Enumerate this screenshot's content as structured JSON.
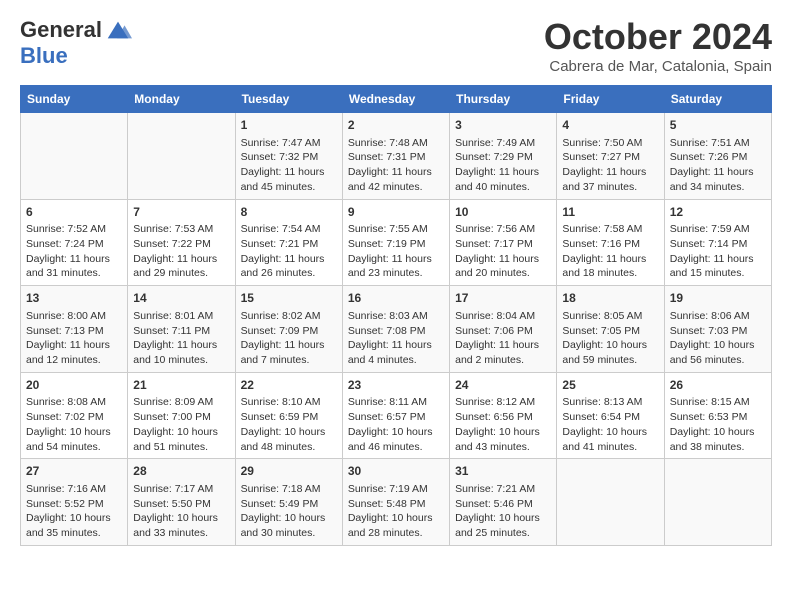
{
  "header": {
    "logo_line1": "General",
    "logo_line2": "Blue",
    "title": "October 2024",
    "subtitle": "Cabrera de Mar, Catalonia, Spain"
  },
  "columns": [
    "Sunday",
    "Monday",
    "Tuesday",
    "Wednesday",
    "Thursday",
    "Friday",
    "Saturday"
  ],
  "weeks": [
    [
      {
        "day": "",
        "sunrise": "",
        "sunset": "",
        "daylight": ""
      },
      {
        "day": "",
        "sunrise": "",
        "sunset": "",
        "daylight": ""
      },
      {
        "day": "1",
        "sunrise": "Sunrise: 7:47 AM",
        "sunset": "Sunset: 7:32 PM",
        "daylight": "Daylight: 11 hours and 45 minutes."
      },
      {
        "day": "2",
        "sunrise": "Sunrise: 7:48 AM",
        "sunset": "Sunset: 7:31 PM",
        "daylight": "Daylight: 11 hours and 42 minutes."
      },
      {
        "day": "3",
        "sunrise": "Sunrise: 7:49 AM",
        "sunset": "Sunset: 7:29 PM",
        "daylight": "Daylight: 11 hours and 40 minutes."
      },
      {
        "day": "4",
        "sunrise": "Sunrise: 7:50 AM",
        "sunset": "Sunset: 7:27 PM",
        "daylight": "Daylight: 11 hours and 37 minutes."
      },
      {
        "day": "5",
        "sunrise": "Sunrise: 7:51 AM",
        "sunset": "Sunset: 7:26 PM",
        "daylight": "Daylight: 11 hours and 34 minutes."
      }
    ],
    [
      {
        "day": "6",
        "sunrise": "Sunrise: 7:52 AM",
        "sunset": "Sunset: 7:24 PM",
        "daylight": "Daylight: 11 hours and 31 minutes."
      },
      {
        "day": "7",
        "sunrise": "Sunrise: 7:53 AM",
        "sunset": "Sunset: 7:22 PM",
        "daylight": "Daylight: 11 hours and 29 minutes."
      },
      {
        "day": "8",
        "sunrise": "Sunrise: 7:54 AM",
        "sunset": "Sunset: 7:21 PM",
        "daylight": "Daylight: 11 hours and 26 minutes."
      },
      {
        "day": "9",
        "sunrise": "Sunrise: 7:55 AM",
        "sunset": "Sunset: 7:19 PM",
        "daylight": "Daylight: 11 hours and 23 minutes."
      },
      {
        "day": "10",
        "sunrise": "Sunrise: 7:56 AM",
        "sunset": "Sunset: 7:17 PM",
        "daylight": "Daylight: 11 hours and 20 minutes."
      },
      {
        "day": "11",
        "sunrise": "Sunrise: 7:58 AM",
        "sunset": "Sunset: 7:16 PM",
        "daylight": "Daylight: 11 hours and 18 minutes."
      },
      {
        "day": "12",
        "sunrise": "Sunrise: 7:59 AM",
        "sunset": "Sunset: 7:14 PM",
        "daylight": "Daylight: 11 hours and 15 minutes."
      }
    ],
    [
      {
        "day": "13",
        "sunrise": "Sunrise: 8:00 AM",
        "sunset": "Sunset: 7:13 PM",
        "daylight": "Daylight: 11 hours and 12 minutes."
      },
      {
        "day": "14",
        "sunrise": "Sunrise: 8:01 AM",
        "sunset": "Sunset: 7:11 PM",
        "daylight": "Daylight: 11 hours and 10 minutes."
      },
      {
        "day": "15",
        "sunrise": "Sunrise: 8:02 AM",
        "sunset": "Sunset: 7:09 PM",
        "daylight": "Daylight: 11 hours and 7 minutes."
      },
      {
        "day": "16",
        "sunrise": "Sunrise: 8:03 AM",
        "sunset": "Sunset: 7:08 PM",
        "daylight": "Daylight: 11 hours and 4 minutes."
      },
      {
        "day": "17",
        "sunrise": "Sunrise: 8:04 AM",
        "sunset": "Sunset: 7:06 PM",
        "daylight": "Daylight: 11 hours and 2 minutes."
      },
      {
        "day": "18",
        "sunrise": "Sunrise: 8:05 AM",
        "sunset": "Sunset: 7:05 PM",
        "daylight": "Daylight: 10 hours and 59 minutes."
      },
      {
        "day": "19",
        "sunrise": "Sunrise: 8:06 AM",
        "sunset": "Sunset: 7:03 PM",
        "daylight": "Daylight: 10 hours and 56 minutes."
      }
    ],
    [
      {
        "day": "20",
        "sunrise": "Sunrise: 8:08 AM",
        "sunset": "Sunset: 7:02 PM",
        "daylight": "Daylight: 10 hours and 54 minutes."
      },
      {
        "day": "21",
        "sunrise": "Sunrise: 8:09 AM",
        "sunset": "Sunset: 7:00 PM",
        "daylight": "Daylight: 10 hours and 51 minutes."
      },
      {
        "day": "22",
        "sunrise": "Sunrise: 8:10 AM",
        "sunset": "Sunset: 6:59 PM",
        "daylight": "Daylight: 10 hours and 48 minutes."
      },
      {
        "day": "23",
        "sunrise": "Sunrise: 8:11 AM",
        "sunset": "Sunset: 6:57 PM",
        "daylight": "Daylight: 10 hours and 46 minutes."
      },
      {
        "day": "24",
        "sunrise": "Sunrise: 8:12 AM",
        "sunset": "Sunset: 6:56 PM",
        "daylight": "Daylight: 10 hours and 43 minutes."
      },
      {
        "day": "25",
        "sunrise": "Sunrise: 8:13 AM",
        "sunset": "Sunset: 6:54 PM",
        "daylight": "Daylight: 10 hours and 41 minutes."
      },
      {
        "day": "26",
        "sunrise": "Sunrise: 8:15 AM",
        "sunset": "Sunset: 6:53 PM",
        "daylight": "Daylight: 10 hours and 38 minutes."
      }
    ],
    [
      {
        "day": "27",
        "sunrise": "Sunrise: 7:16 AM",
        "sunset": "Sunset: 5:52 PM",
        "daylight": "Daylight: 10 hours and 35 minutes."
      },
      {
        "day": "28",
        "sunrise": "Sunrise: 7:17 AM",
        "sunset": "Sunset: 5:50 PM",
        "daylight": "Daylight: 10 hours and 33 minutes."
      },
      {
        "day": "29",
        "sunrise": "Sunrise: 7:18 AM",
        "sunset": "Sunset: 5:49 PM",
        "daylight": "Daylight: 10 hours and 30 minutes."
      },
      {
        "day": "30",
        "sunrise": "Sunrise: 7:19 AM",
        "sunset": "Sunset: 5:48 PM",
        "daylight": "Daylight: 10 hours and 28 minutes."
      },
      {
        "day": "31",
        "sunrise": "Sunrise: 7:21 AM",
        "sunset": "Sunset: 5:46 PM",
        "daylight": "Daylight: 10 hours and 25 minutes."
      },
      {
        "day": "",
        "sunrise": "",
        "sunset": "",
        "daylight": ""
      },
      {
        "day": "",
        "sunrise": "",
        "sunset": "",
        "daylight": ""
      }
    ]
  ]
}
